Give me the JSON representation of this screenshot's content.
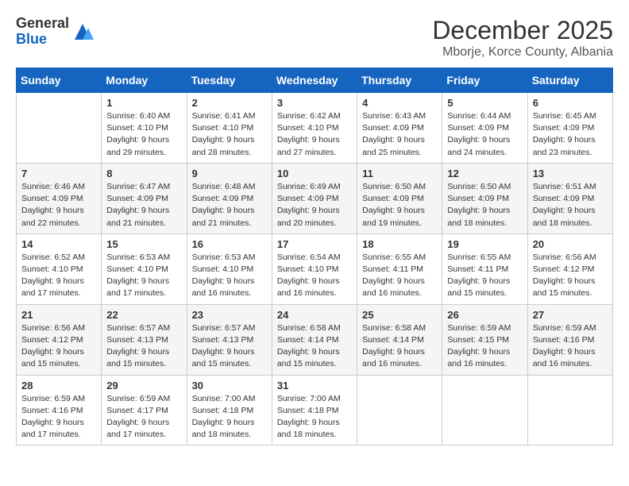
{
  "logo": {
    "general": "General",
    "blue": "Blue"
  },
  "header": {
    "month": "December 2025",
    "location": "Mborje, Korce County, Albania"
  },
  "days_of_week": [
    "Sunday",
    "Monday",
    "Tuesday",
    "Wednesday",
    "Thursday",
    "Friday",
    "Saturday"
  ],
  "weeks": [
    [
      {
        "day": "",
        "info": ""
      },
      {
        "day": "1",
        "info": "Sunrise: 6:40 AM\nSunset: 4:10 PM\nDaylight: 9 hours\nand 29 minutes."
      },
      {
        "day": "2",
        "info": "Sunrise: 6:41 AM\nSunset: 4:10 PM\nDaylight: 9 hours\nand 28 minutes."
      },
      {
        "day": "3",
        "info": "Sunrise: 6:42 AM\nSunset: 4:10 PM\nDaylight: 9 hours\nand 27 minutes."
      },
      {
        "day": "4",
        "info": "Sunrise: 6:43 AM\nSunset: 4:09 PM\nDaylight: 9 hours\nand 25 minutes."
      },
      {
        "day": "5",
        "info": "Sunrise: 6:44 AM\nSunset: 4:09 PM\nDaylight: 9 hours\nand 24 minutes."
      },
      {
        "day": "6",
        "info": "Sunrise: 6:45 AM\nSunset: 4:09 PM\nDaylight: 9 hours\nand 23 minutes."
      }
    ],
    [
      {
        "day": "7",
        "info": "Sunrise: 6:46 AM\nSunset: 4:09 PM\nDaylight: 9 hours\nand 22 minutes."
      },
      {
        "day": "8",
        "info": "Sunrise: 6:47 AM\nSunset: 4:09 PM\nDaylight: 9 hours\nand 21 minutes."
      },
      {
        "day": "9",
        "info": "Sunrise: 6:48 AM\nSunset: 4:09 PM\nDaylight: 9 hours\nand 21 minutes."
      },
      {
        "day": "10",
        "info": "Sunrise: 6:49 AM\nSunset: 4:09 PM\nDaylight: 9 hours\nand 20 minutes."
      },
      {
        "day": "11",
        "info": "Sunrise: 6:50 AM\nSunset: 4:09 PM\nDaylight: 9 hours\nand 19 minutes."
      },
      {
        "day": "12",
        "info": "Sunrise: 6:50 AM\nSunset: 4:09 PM\nDaylight: 9 hours\nand 18 minutes."
      },
      {
        "day": "13",
        "info": "Sunrise: 6:51 AM\nSunset: 4:09 PM\nDaylight: 9 hours\nand 18 minutes."
      }
    ],
    [
      {
        "day": "14",
        "info": "Sunrise: 6:52 AM\nSunset: 4:10 PM\nDaylight: 9 hours\nand 17 minutes."
      },
      {
        "day": "15",
        "info": "Sunrise: 6:53 AM\nSunset: 4:10 PM\nDaylight: 9 hours\nand 17 minutes."
      },
      {
        "day": "16",
        "info": "Sunrise: 6:53 AM\nSunset: 4:10 PM\nDaylight: 9 hours\nand 16 minutes."
      },
      {
        "day": "17",
        "info": "Sunrise: 6:54 AM\nSunset: 4:10 PM\nDaylight: 9 hours\nand 16 minutes."
      },
      {
        "day": "18",
        "info": "Sunrise: 6:55 AM\nSunset: 4:11 PM\nDaylight: 9 hours\nand 16 minutes."
      },
      {
        "day": "19",
        "info": "Sunrise: 6:55 AM\nSunset: 4:11 PM\nDaylight: 9 hours\nand 15 minutes."
      },
      {
        "day": "20",
        "info": "Sunrise: 6:56 AM\nSunset: 4:12 PM\nDaylight: 9 hours\nand 15 minutes."
      }
    ],
    [
      {
        "day": "21",
        "info": "Sunrise: 6:56 AM\nSunset: 4:12 PM\nDaylight: 9 hours\nand 15 minutes."
      },
      {
        "day": "22",
        "info": "Sunrise: 6:57 AM\nSunset: 4:13 PM\nDaylight: 9 hours\nand 15 minutes."
      },
      {
        "day": "23",
        "info": "Sunrise: 6:57 AM\nSunset: 4:13 PM\nDaylight: 9 hours\nand 15 minutes."
      },
      {
        "day": "24",
        "info": "Sunrise: 6:58 AM\nSunset: 4:14 PM\nDaylight: 9 hours\nand 15 minutes."
      },
      {
        "day": "25",
        "info": "Sunrise: 6:58 AM\nSunset: 4:14 PM\nDaylight: 9 hours\nand 16 minutes."
      },
      {
        "day": "26",
        "info": "Sunrise: 6:59 AM\nSunset: 4:15 PM\nDaylight: 9 hours\nand 16 minutes."
      },
      {
        "day": "27",
        "info": "Sunrise: 6:59 AM\nSunset: 4:16 PM\nDaylight: 9 hours\nand 16 minutes."
      }
    ],
    [
      {
        "day": "28",
        "info": "Sunrise: 6:59 AM\nSunset: 4:16 PM\nDaylight: 9 hours\nand 17 minutes."
      },
      {
        "day": "29",
        "info": "Sunrise: 6:59 AM\nSunset: 4:17 PM\nDaylight: 9 hours\nand 17 minutes."
      },
      {
        "day": "30",
        "info": "Sunrise: 7:00 AM\nSunset: 4:18 PM\nDaylight: 9 hours\nand 18 minutes."
      },
      {
        "day": "31",
        "info": "Sunrise: 7:00 AM\nSunset: 4:18 PM\nDaylight: 9 hours\nand 18 minutes."
      },
      {
        "day": "",
        "info": ""
      },
      {
        "day": "",
        "info": ""
      },
      {
        "day": "",
        "info": ""
      }
    ]
  ]
}
